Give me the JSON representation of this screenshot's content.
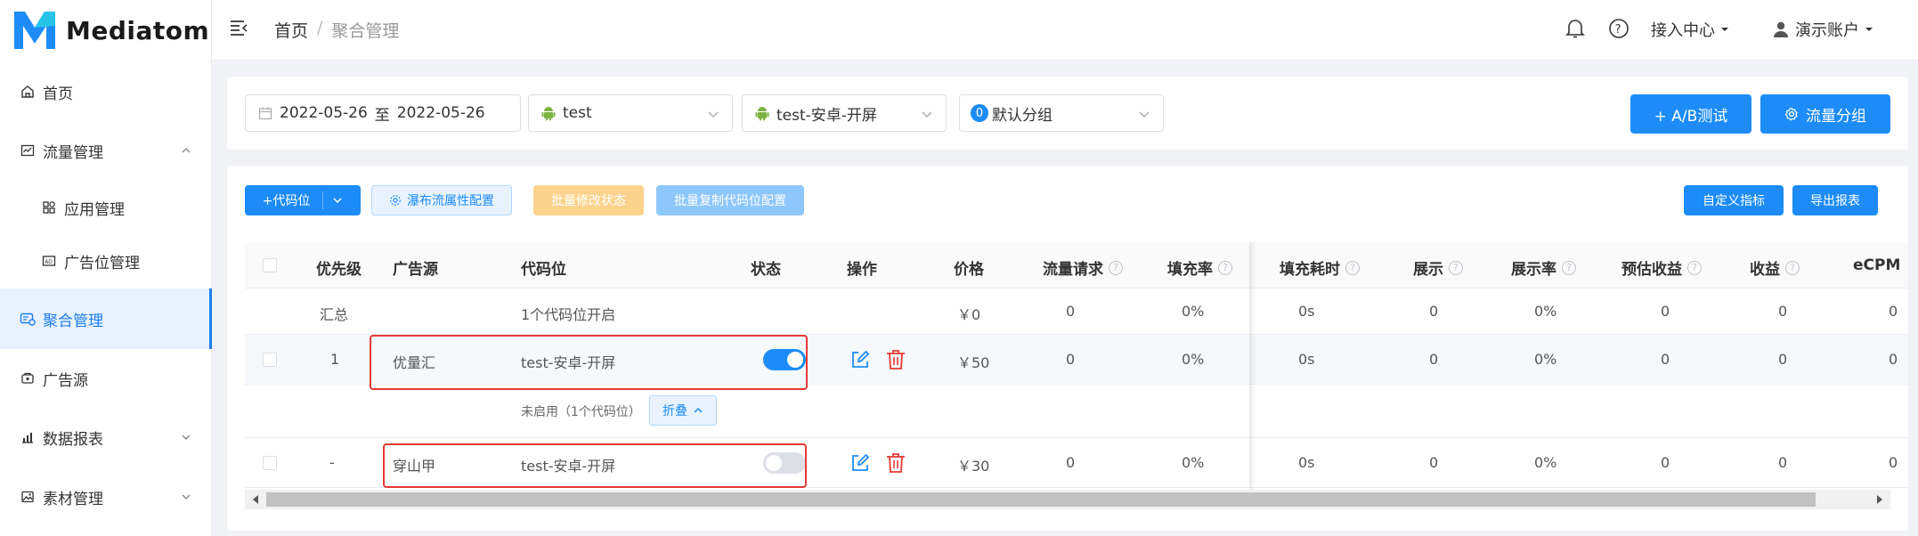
{
  "brand": {
    "name": "Mediatom",
    "colors": {
      "primary": "#1d8cf8",
      "accent_cyan": "#27c4e8",
      "danger": "#e53935"
    }
  },
  "sidebar": {
    "items": [
      {
        "label": "首页",
        "icon": "home-icon"
      },
      {
        "label": "流量管理",
        "icon": "chart-icon",
        "expanded": true
      },
      {
        "label": "应用管理",
        "icon": "apps-icon",
        "sub": true
      },
      {
        "label": "广告位管理",
        "icon": "ad-icon",
        "sub": true
      },
      {
        "label": "聚合管理",
        "icon": "aggregate-icon",
        "active": true
      },
      {
        "label": "广告源",
        "icon": "source-icon"
      },
      {
        "label": "数据报表",
        "icon": "report-icon",
        "expanded": false
      },
      {
        "label": "素材管理",
        "icon": "material-icon",
        "expanded": false
      }
    ]
  },
  "topbar": {
    "breadcrumb": {
      "home": "首页",
      "sep": "/",
      "current": "聚合管理"
    },
    "access_center": "接入中心",
    "account": "演示账户"
  },
  "filters": {
    "date_start": "2022-05-26",
    "date_sep": "至",
    "date_end": "2022-05-26",
    "app": "test",
    "placement": "test-安卓-开屏",
    "group_badge": "0",
    "group": "默认分组",
    "ab_test_button": "+ A/B测试",
    "traffic_group_button": "流量分组"
  },
  "toolbar": {
    "add_code_button": "+代码位",
    "waterfall_config_button": "瀑布流属性配置",
    "batch_status_button": "批量修改状态",
    "batch_copy_button": "批量复制代码位配置",
    "custom_metrics_button": "自定义指标",
    "export_button": "导出报表"
  },
  "table": {
    "columns": [
      "优先级",
      "广告源",
      "代码位",
      "状态",
      "操作",
      "价格",
      "流量请求",
      "填充率",
      "填充耗时",
      "展示",
      "展示率",
      "预估收益",
      "收益",
      "eCPM"
    ],
    "summary": {
      "priority": "汇总",
      "code": "1个代码位开启",
      "price": "￥0",
      "metrics": [
        "0",
        "0%",
        "0s",
        "0",
        "0%",
        "0",
        "0",
        "0"
      ]
    },
    "rows": [
      {
        "priority": "1",
        "source": "优量汇",
        "code": "test-安卓-开屏",
        "enabled": true,
        "price": "￥50",
        "metrics": [
          "0",
          "0%",
          "0s",
          "0",
          "0%",
          "0",
          "0",
          "0"
        ]
      },
      {
        "priority": "-",
        "source": "穿山甲",
        "code": "test-安卓-开屏",
        "enabled": false,
        "price": "￥30",
        "metrics": [
          "0",
          "0%",
          "0s",
          "0",
          "0%",
          "0",
          "0",
          "0"
        ]
      }
    ],
    "disabled_note": "未启用（1个代码位）",
    "collapse_label": "折叠"
  }
}
